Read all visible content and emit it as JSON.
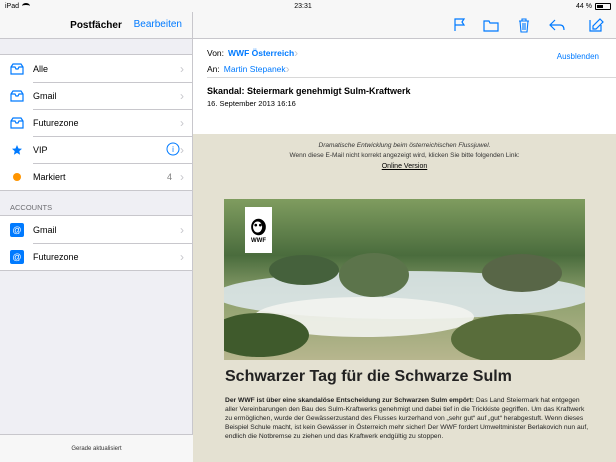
{
  "status": {
    "device": "iPad",
    "time": "23:31",
    "battery": "44 %"
  },
  "sidebar": {
    "title": "Postfächer",
    "edit": "Bearbeiten",
    "accounts_label": "ACCOUNTS",
    "updated": "Gerade aktualisiert",
    "items": [
      {
        "label": "Alle",
        "icon": "inbox-icon"
      },
      {
        "label": "Gmail",
        "icon": "inbox-icon"
      },
      {
        "label": "Futurezone",
        "icon": "inbox-icon"
      },
      {
        "label": "VIP",
        "icon": "star-icon",
        "extra": "info-icon"
      },
      {
        "label": "Markiert",
        "icon": "flag-dot-icon",
        "count": "4"
      }
    ],
    "accounts": [
      {
        "label": "Gmail",
        "icon": "at-icon"
      },
      {
        "label": "Futurezone",
        "icon": "at-icon"
      }
    ]
  },
  "mail": {
    "from_label": "Von:",
    "from": "WWF Österreich",
    "to_label": "An:",
    "to": "Martin Stepanek",
    "hide": "Ausblenden",
    "subject": "Skandal: Steiermark genehmigt Sulm-Kraftwerk",
    "date": "16. September 2013 16:16",
    "intro_italic": "Dramatische Entwicklung beim österreichischen Flussjuwel.",
    "intro_link_text": "Wenn diese E-Mail nicht korrekt angezeigt wird, klicken Sie bitte folgenden Link:",
    "online": "Online Version",
    "headline": "Schwarzer Tag für die Schwarze Sulm",
    "lead": "Der WWF ist über eine skandalöse Entscheidung zur Schwarzen Sulm empört:",
    "body": " Das Land Steiermark hat entgegen aller Vereinbarungen den Bau des Sulm-Kraftwerks genehmigt und dabei tief in die Trickkiste gegriffen. Um das Kraftwerk zu ermöglichen, wurde der Gewässerzustand des Flusses kurzerhand von „sehr gut“ auf „gut“ herabgestuft. Wenn dieses Beispiel Schule macht, ist kein Gewässer in Österreich mehr sicher! Der WWF fordert Umweltminister Berlakovich nun auf, endlich die Notbremse zu ziehen und das Kraftwerk endgültig zu stoppen.",
    "logo_text": "WWF"
  },
  "colors": {
    "accent": "#007aff",
    "mail_bg": "#e4e1d2"
  }
}
